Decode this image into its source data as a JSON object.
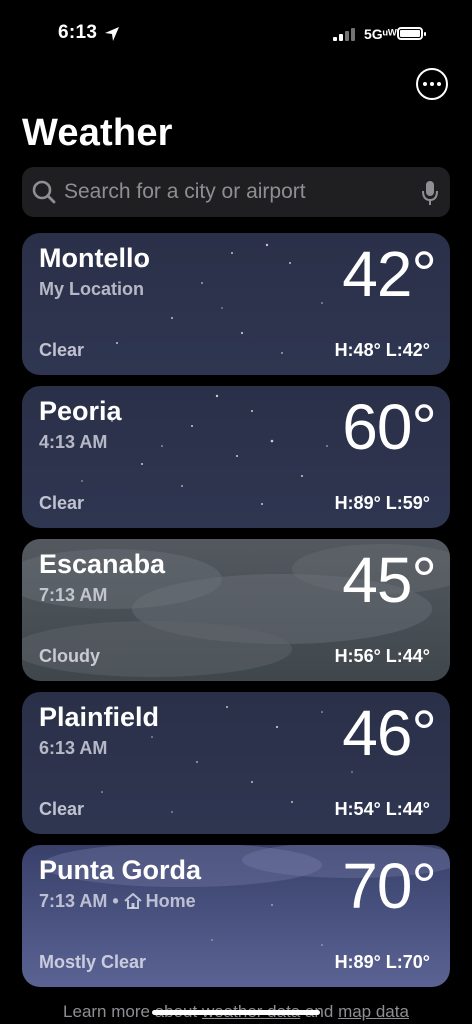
{
  "status": {
    "time": "6:13",
    "network": "5Gᵘᵂ"
  },
  "header": {
    "title": "Weather"
  },
  "search": {
    "placeholder": "Search for a city or airport"
  },
  "cards": [
    {
      "city": "Montello",
      "subtitle": "My Location",
      "temp": "42°",
      "condition": "Clear",
      "hilo": "H:48°  L:42°",
      "style": "night"
    },
    {
      "city": "Peoria",
      "subtitle": "4:13 AM",
      "temp": "60°",
      "condition": "Clear",
      "hilo": "H:89°  L:59°",
      "style": "night"
    },
    {
      "city": "Escanaba",
      "subtitle": "7:13 AM",
      "temp": "45°",
      "condition": "Cloudy",
      "hilo": "H:56°  L:44°",
      "style": "cloudy"
    },
    {
      "city": "Plainfield",
      "subtitle": "6:13 AM",
      "temp": "46°",
      "condition": "Clear",
      "hilo": "H:54°  L:44°",
      "style": "night"
    },
    {
      "city": "Punta Gorda",
      "subtitle": "7:13 AM • ",
      "subtitle_extra": "Home",
      "temp": "70°",
      "condition": "Mostly Clear",
      "hilo": "H:89°  L:70°",
      "style": "mostly"
    }
  ],
  "footer": {
    "text_prefix": "Learn more about ",
    "link1": "weather data",
    "middle": " and ",
    "link2": "map data"
  },
  "icons": {
    "location": "location-arrow-icon",
    "more": "ellipsis-circle-icon",
    "search": "magnifier-icon",
    "mic": "microphone-icon",
    "home": "house-icon"
  }
}
